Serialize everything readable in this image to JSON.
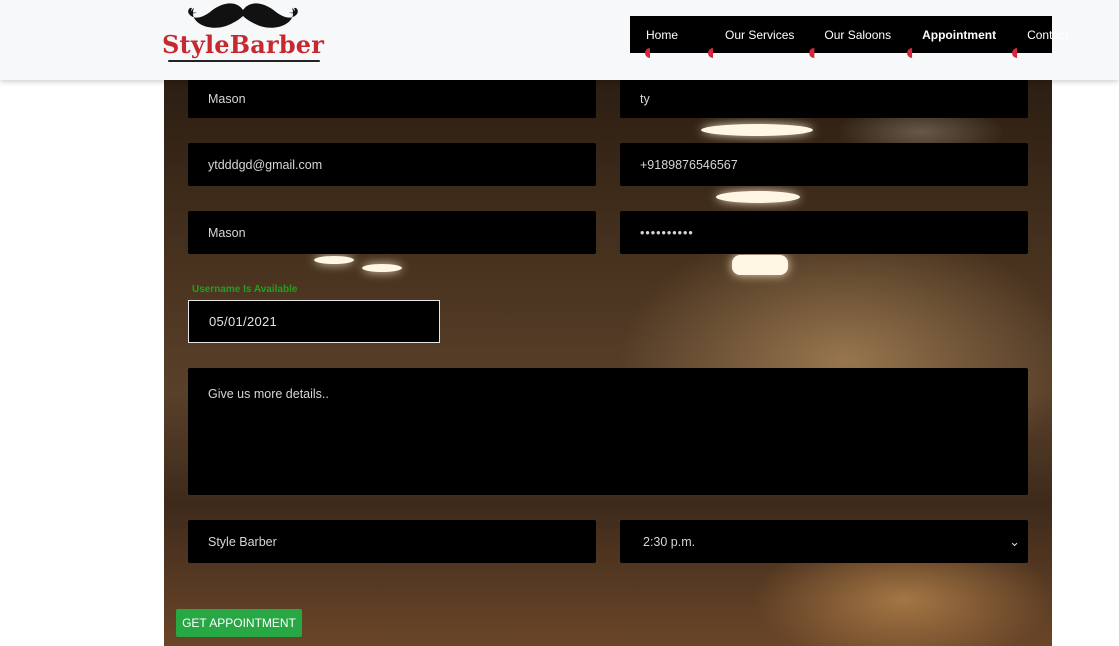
{
  "brand": {
    "logo_text": "StyleBarber",
    "logo_color": "#c62a2f"
  },
  "nav": {
    "items": [
      {
        "label": "Home",
        "active": false
      },
      {
        "label": "Our Services",
        "active": false
      },
      {
        "label": "Our Saloons",
        "active": false
      },
      {
        "label": "Appointment",
        "active": true
      },
      {
        "label": "Contact",
        "active": false
      }
    ],
    "background": "#000000",
    "accent": "#d6283d"
  },
  "form": {
    "first_name": "Mason",
    "last_name": "ty",
    "email": "ytdddgd@gmail.com",
    "phone": "+9189876546567",
    "username": "Mason",
    "password_masked": "••••••••••",
    "username_status": "Username Is Available",
    "date": "05/01/2021",
    "details_placeholder": "Give us more details..",
    "saloon": "Style Barber",
    "time": "2:30 p.m.",
    "submit_label": "GET APPOINTMENT"
  },
  "colors": {
    "submit": "#28a745",
    "status_ok": "#1fa11f"
  }
}
